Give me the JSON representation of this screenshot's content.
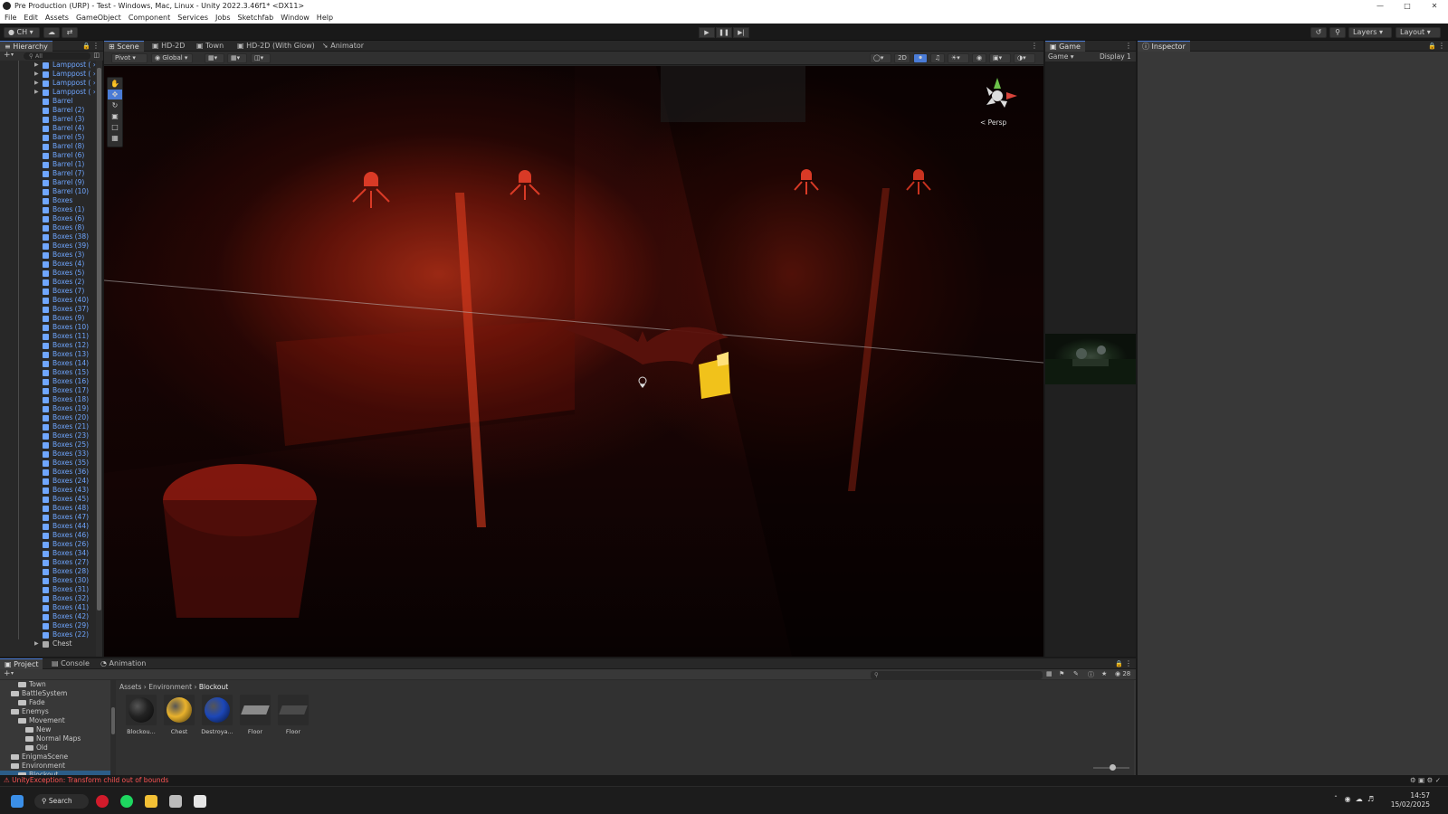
{
  "window": {
    "title": "Pre Production (URP) - Test - Windows, Mac, Linux - Unity 2022.3.46f1* <DX11>",
    "controls": [
      "—",
      "□",
      "✕"
    ]
  },
  "menu": [
    "File",
    "Edit",
    "Assets",
    "GameObject",
    "Component",
    "Services",
    "Jobs",
    "Sketchfab",
    "Window",
    "Help"
  ],
  "toolbar": {
    "account": "CH",
    "layers_label": "Layers",
    "layout_label": "Layout"
  },
  "hierarchy": {
    "tab": "Hierarchy",
    "search_placeholder": "All",
    "items": [
      "Lamppost (",
      "Lamppost (",
      "Lamppost (",
      "Lamppost (",
      "Barrel",
      "Barrel (2)",
      "Barrel (3)",
      "Barrel (4)",
      "Barrel (5)",
      "Barrel (8)",
      "Barrel (6)",
      "Barrel (1)",
      "Barrel (7)",
      "Barrel (9)",
      "Barrel (10)",
      "Boxes",
      "Boxes (1)",
      "Boxes (6)",
      "Boxes (8)",
      "Boxes (38)",
      "Boxes (39)",
      "Boxes (3)",
      "Boxes (4)",
      "Boxes (5)",
      "Boxes (2)",
      "Boxes (7)",
      "Boxes (40)",
      "Boxes (37)",
      "Boxes (9)",
      "Boxes (10)",
      "Boxes (11)",
      "Boxes (12)",
      "Boxes (13)",
      "Boxes (14)",
      "Boxes (15)",
      "Boxes (16)",
      "Boxes (17)",
      "Boxes (18)",
      "Boxes (19)",
      "Boxes (20)",
      "Boxes (21)",
      "Boxes (23)",
      "Boxes (25)",
      "Boxes (33)",
      "Boxes (35)",
      "Boxes (36)",
      "Boxes (24)",
      "Boxes (43)",
      "Boxes (45)",
      "Boxes (48)",
      "Boxes (47)",
      "Boxes (44)",
      "Boxes (46)",
      "Boxes (26)",
      "Boxes (34)",
      "Boxes (27)",
      "Boxes (28)",
      "Boxes (30)",
      "Boxes (31)",
      "Boxes (32)",
      "Boxes (41)",
      "Boxes (42)",
      "Boxes (29)",
      "Boxes (22)",
      "Chest"
    ]
  },
  "scene_tabs": [
    "Scene",
    "HD-2D",
    "Town",
    "HD-2D (With Glow)",
    "Animator"
  ],
  "scene_toolbar": {
    "pivot": "Pivot",
    "global": "Global",
    "mode_2d": "2D",
    "persp": "Persp"
  },
  "game": {
    "tab": "Game",
    "mode": "Game",
    "display": "Display 1"
  },
  "inspector": {
    "tab": "Inspector"
  },
  "project": {
    "tabs": [
      "Project",
      "Console",
      "Animation"
    ],
    "breadcrumb": [
      "Assets",
      "Environment",
      "Blockout"
    ],
    "count": "28",
    "tree": [
      {
        "label": "Town",
        "indent": 2
      },
      {
        "label": "BattleSystem",
        "indent": 1
      },
      {
        "label": "Fade",
        "indent": 2
      },
      {
        "label": "Enemys",
        "indent": 1
      },
      {
        "label": "Movement",
        "indent": 2
      },
      {
        "label": "New",
        "indent": 3
      },
      {
        "label": "Normal Maps",
        "indent": 3
      },
      {
        "label": "Old",
        "indent": 3
      },
      {
        "label": "EnigmaScene",
        "indent": 1
      },
      {
        "label": "Environment",
        "indent": 1
      },
      {
        "label": "Blockout",
        "indent": 2
      }
    ],
    "assets": [
      {
        "label": "Blockou...",
        "swatch": "#222222"
      },
      {
        "label": "Chest",
        "swatch": "#e9b22c"
      },
      {
        "label": "Destroya...",
        "swatch": "#1c47b8"
      },
      {
        "label": "Floor",
        "swatch": "#8a8a8a"
      },
      {
        "label": "Floor",
        "swatch": "#4a4a4a"
      }
    ]
  },
  "status": {
    "error": "UnityException: Transform child out of bounds"
  },
  "taskbar": {
    "search": "Search",
    "time": "14:57",
    "date": "15/02/2025"
  },
  "colors": {
    "accent": "#4a7bd6",
    "hierarchy_text": "#6fa6ff",
    "error": "#ff5555"
  }
}
